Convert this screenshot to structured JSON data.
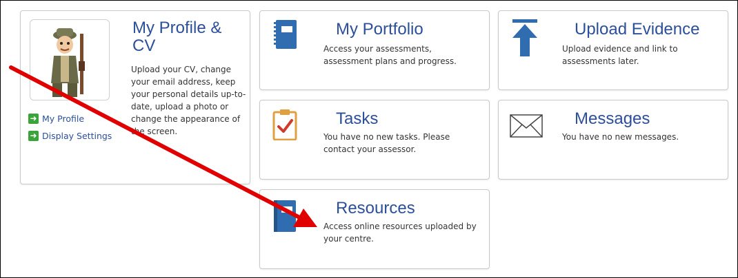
{
  "profile_card": {
    "title": "My Profile & CV",
    "description": "Upload your CV, change your email address, keep your personal details up-to-date, upload a photo or change the appearance of the screen.",
    "links": [
      {
        "label": "My Profile",
        "icon": "arrow-right-icon"
      },
      {
        "label": "Display Settings",
        "icon": "arrow-right-icon"
      }
    ]
  },
  "portfolio_card": {
    "title": "My Portfolio",
    "description": "Access your assessments, assessment plans and progress.",
    "icon": "notebook-icon"
  },
  "upload_card": {
    "title": "Upload Evidence",
    "description": "Upload evidence and link to assessments later.",
    "icon": "upload-arrow-icon"
  },
  "tasks_card": {
    "title": "Tasks",
    "description": "You have no new tasks. Please contact your assessor.",
    "icon": "clipboard-check-icon"
  },
  "messages_card": {
    "title": "Messages",
    "description": "You have no new messages.",
    "icon": "envelope-icon"
  },
  "resources_card": {
    "title": "Resources",
    "description": "Access online resources uploaded by your centre.",
    "icon": "book-icon"
  },
  "colors": {
    "title_blue": "#2b4f9a",
    "icon_blue": "#2f6db0",
    "link_green": "#3aa33a",
    "annotation_red": "#e00000",
    "tasks_orange": "#e0a040",
    "tasks_check": "#d03a2a"
  }
}
